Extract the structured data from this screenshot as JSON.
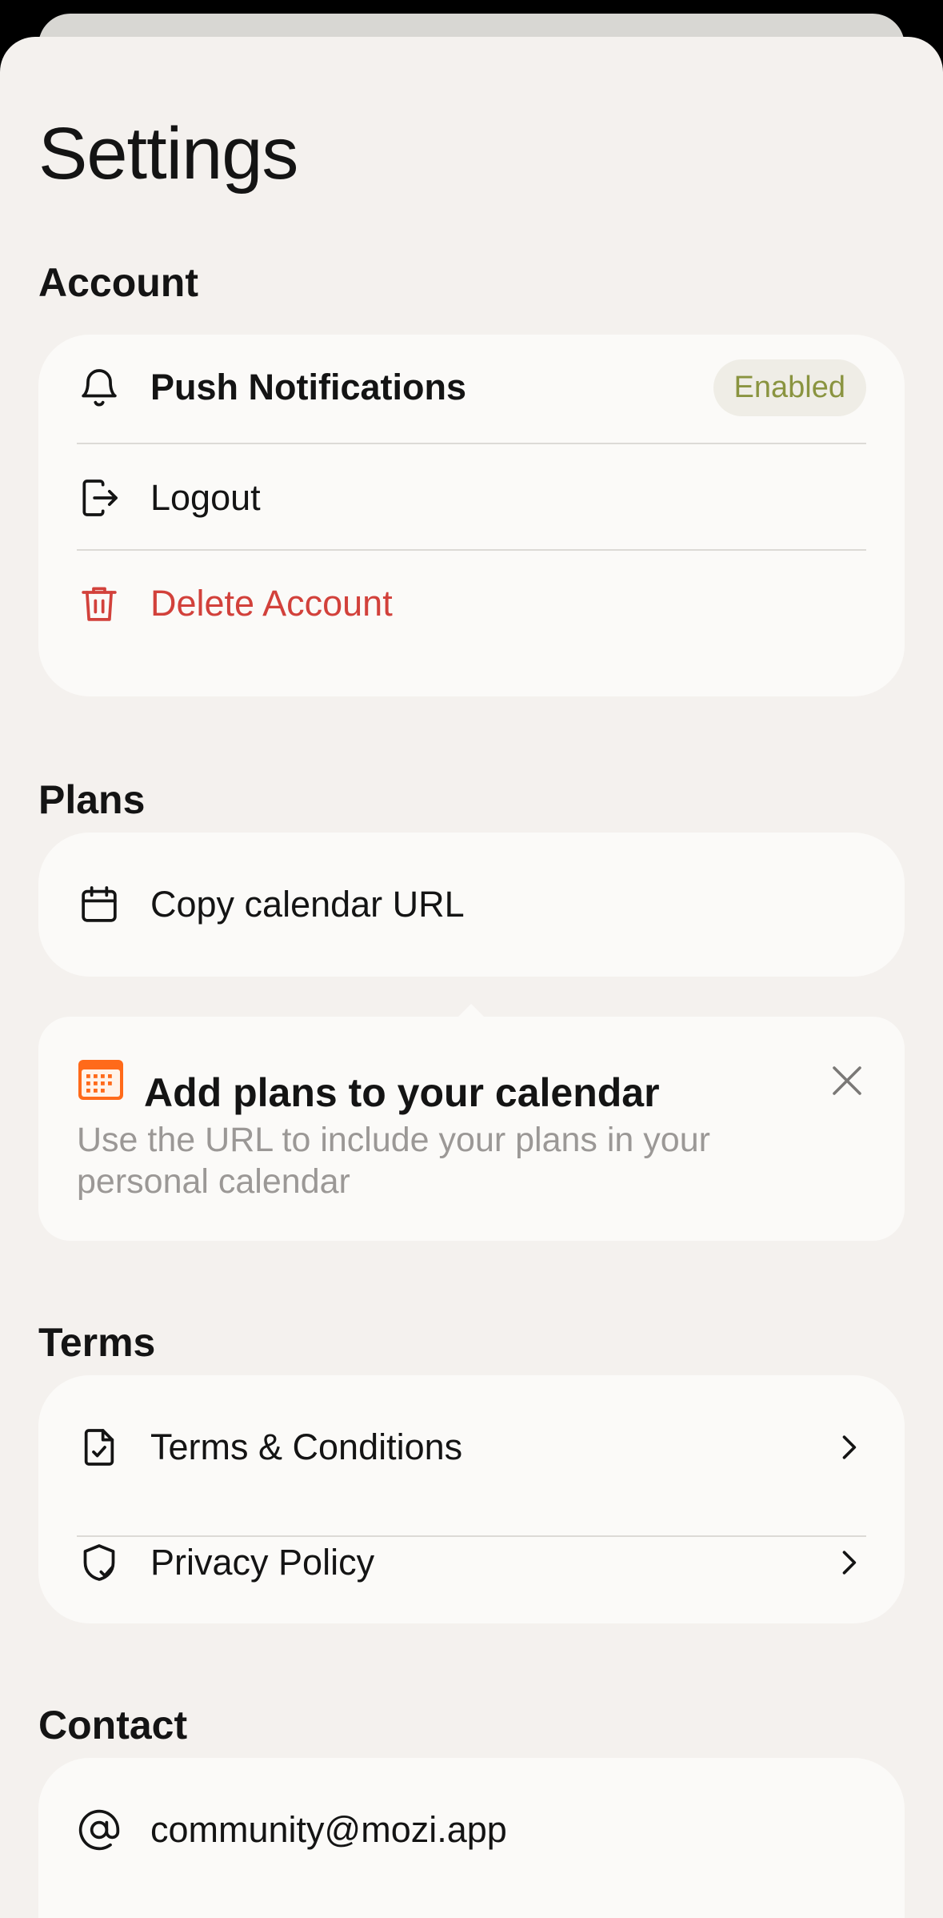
{
  "page_title": "Settings",
  "colors": {
    "danger": "#d2413b",
    "badge_text": "#8a9440",
    "calendar_icon": "#ff6a1a"
  },
  "account": {
    "title": "Account",
    "push": {
      "label": "Push Notifications",
      "status": "Enabled",
      "icon": "bell-icon"
    },
    "logout": {
      "label": "Logout",
      "icon": "logout-icon"
    },
    "delete": {
      "label": "Delete Account",
      "icon": "trash-icon"
    }
  },
  "plans": {
    "title": "Plans",
    "copy": {
      "label": "Copy calendar URL",
      "icon": "calendar-icon"
    },
    "tip": {
      "title": "Add plans to your calendar",
      "body": "Use the URL to include your plans in your personal calendar"
    }
  },
  "terms": {
    "title": "Terms",
    "items": [
      {
        "label": "Terms & Conditions",
        "icon": "document-check-icon"
      },
      {
        "label": "Privacy Policy",
        "icon": "shield-check-icon"
      }
    ]
  },
  "contact": {
    "title": "Contact",
    "email": "community@mozi.app"
  }
}
